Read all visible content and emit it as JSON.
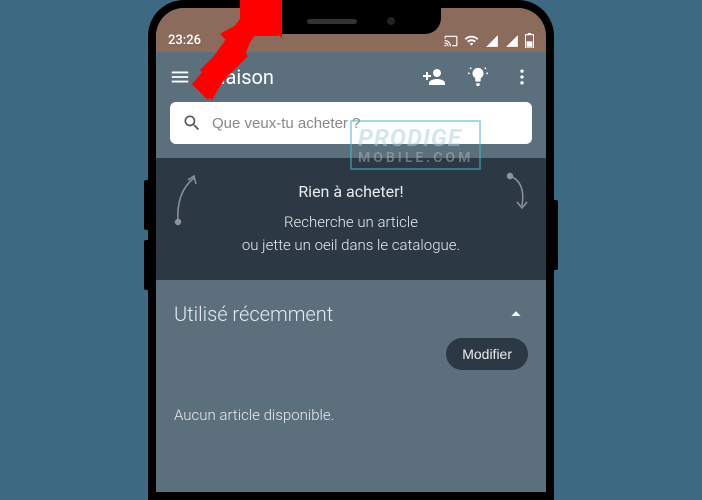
{
  "status": {
    "time": "23:26"
  },
  "appbar": {
    "title": "Maison"
  },
  "search": {
    "placeholder": "Que veux-tu acheter ?"
  },
  "empty": {
    "title": "Rien à acheter!",
    "line1": "Recherche un article",
    "line2": "ou jette un oeil dans le catalogue."
  },
  "recent": {
    "title": "Utilisé récemment",
    "modify": "Modifier",
    "none": "Aucun article disponible."
  },
  "watermark": {
    "l1": "PRODIGE",
    "l2": "MOBILE.COM"
  }
}
